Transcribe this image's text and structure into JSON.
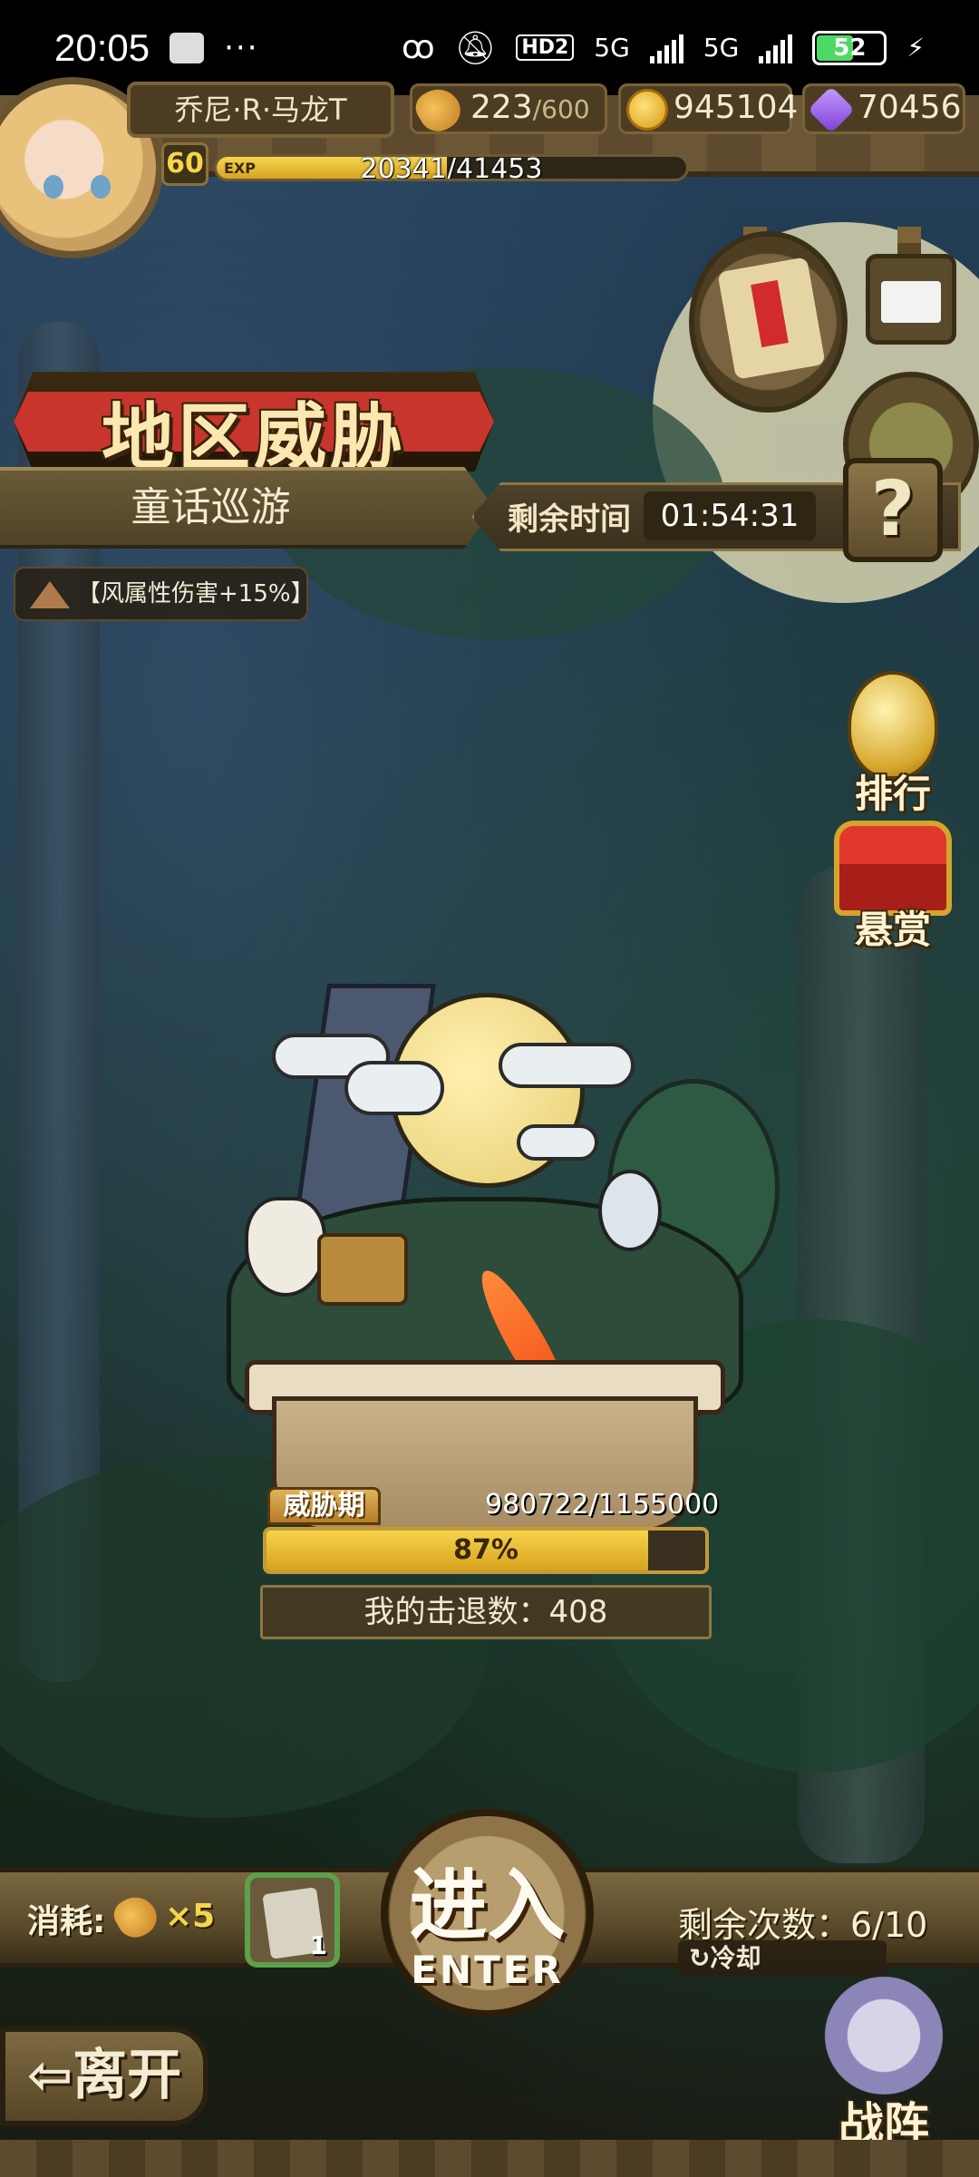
{
  "status_bar": {
    "time": "20:05",
    "dots": "···",
    "hd": "HD2",
    "net1": "5G",
    "net2": "5G",
    "battery": "52"
  },
  "player": {
    "name": "乔尼·R·马龙T",
    "level": "60",
    "exp_label": "EXP",
    "exp_text": "20341/41453",
    "exp_fraction": 0.49
  },
  "resources": {
    "stamina": "223",
    "stamina_max": "/600",
    "gold": "945104",
    "gems": "70456"
  },
  "event": {
    "title": "地区威胁",
    "region": "童话巡游",
    "time_label": "剩余时间",
    "time_value": "01:54:31",
    "help": "?",
    "buff": "【风属性伤害+15%】"
  },
  "side_menu": {
    "ranking": "排行",
    "reward": "悬赏"
  },
  "threat": {
    "tag": "威胁期",
    "value": "980722/1155000",
    "percent_label": "87%",
    "fraction": 0.87,
    "kills": "我的击退数：408"
  },
  "bottom": {
    "cost_label": "消耗:",
    "cost_value": "×5",
    "ticket_count": "1",
    "enter_cn": "进入",
    "enter_en": "ENTER",
    "remaining": "剩余次数：6/10",
    "cooldown": "↻冷却",
    "leave": "⇦离开",
    "formation": "战阵"
  }
}
